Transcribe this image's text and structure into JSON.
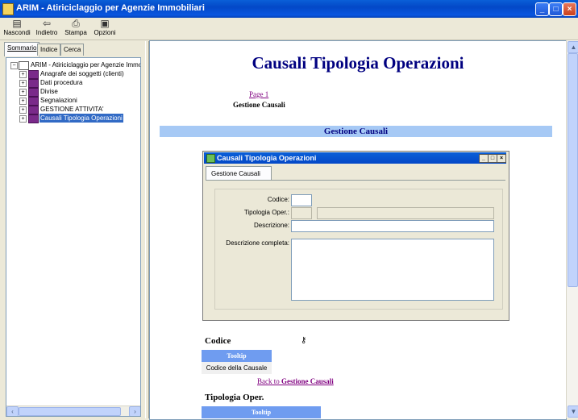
{
  "window": {
    "title": "ARIM - Atiriciclaggio per Agenzie Immobiliari"
  },
  "toolbar": {
    "hide": "Nascondi",
    "back": "Indietro",
    "print": "Stampa",
    "options": "Opzioni"
  },
  "tabs": {
    "contents": "Sommario",
    "index": "Indice",
    "search": "Cerca"
  },
  "tree": {
    "root": "ARIM - Atiriciclaggio per Agenzie Immob",
    "items": [
      "Anagrafe dei soggetti (clienti)",
      "Dati procedura",
      "Divise",
      "Segnalazioni",
      "GESTIONE ATTIVITA'",
      "Causali Tipologia Operazioni"
    ]
  },
  "page": {
    "title": "Causali Tipologia Operazioni",
    "page_link": "Page 1",
    "subtitle": "Gestione Causali",
    "section": "Gestione Causali",
    "dialog": {
      "title": "Causali Tipologia Operazioni",
      "tab": "Gestione Causali",
      "codice": "Codice:",
      "tipologia": "Tipologia Oper.:",
      "descrizione": "Descrizione:",
      "descrizione_completa": "Descrizione completa:"
    },
    "field1": {
      "name": "Codice",
      "tooltip_hdr": "Tooltip",
      "tooltip": "Codice della Causale"
    },
    "back_prefix": "Back to ",
    "back_target": "Gestione Causali",
    "field2": {
      "name": "Tipologia Oper.",
      "tooltip_hdr": "Tooltip"
    }
  }
}
